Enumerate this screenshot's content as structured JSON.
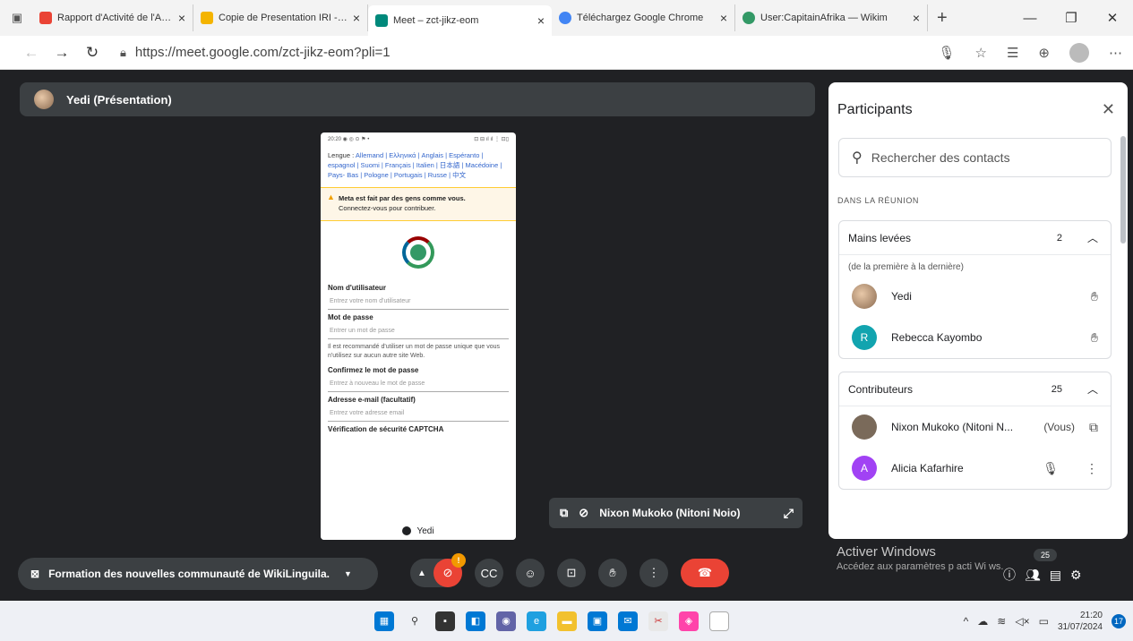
{
  "browser": {
    "tabs": [
      {
        "label": "Rapport d'Activité de l'Atelie",
        "color": "#ea4335"
      },
      {
        "label": "Copie de Presentation IRI - G",
        "color": "#f4b400"
      },
      {
        "label": "Meet – zct-jikz-eom",
        "color": "#00897b"
      },
      {
        "label": "Téléchargez Google Chrome",
        "color": "#4285f4"
      },
      {
        "label": "User:CapitainAfrika — Wikim",
        "color": "#339966"
      }
    ],
    "url": "https://meet.google.com/zct-jikz-eom?pli=1"
  },
  "presentation": {
    "presenter": "Yedi (Présentation)"
  },
  "phone": {
    "status_left": "20:20 ◉ ◎ ⊙ ⚑ •",
    "status_right": "⊡ ⊟ ıl ıl ⋮ ⊡▯",
    "lang_prefix": "Lengue : ",
    "lang_links": "Allemand | Ελληνικά | Anglais | Espéranto | espagnol | Suomi | Français | Italien | 日本語 | Macédoine | Pays- Bas | Pologne | Portugais | Russe | 中文",
    "warn_title": "Meta est fait par des gens comme vous.",
    "warn_text": "Connectez-vous pour contribuer.",
    "username_label": "Nom d'utilisateur",
    "username_ph": "Entrez votre nom d'utilisateur",
    "password_label": "Mot de passe",
    "password_ph": "Entrer un mot de passe",
    "password_hint": "Il est recommandé d'utiliser un mot de passe unique que vous n'utilisez sur aucun autre site Web.",
    "confirm_label": "Confirmez le mot de passe",
    "confirm_ph": "Entrez à nouveau le mot de passe",
    "email_label": "Adresse e-mail (facultatif)",
    "email_ph": "Entrez votre adresse email",
    "captcha_label": "Vérification de sécurité CAPTCHA",
    "footer_name": "Yedi"
  },
  "pinned": {
    "name": "Nixon Mukoko (Nitoni Noio)"
  },
  "meeting": {
    "title": "Formation des nouvelles communauté de WikiLinguila.",
    "mic_badge": "!"
  },
  "participants": {
    "title": "Participants",
    "search_placeholder": "Rechercher des contacts",
    "section": "DANS LA RÉUNION",
    "raised": {
      "title": "Mains levées",
      "count": "2",
      "subtitle": "(de la première à la dernière)",
      "people": [
        {
          "name": "Yedi",
          "initial": "",
          "color": "#a0785a"
        },
        {
          "name": "Rebecca Kayombo",
          "initial": "R",
          "color": "#12a4af"
        }
      ]
    },
    "contributors": {
      "title": "Contributeurs",
      "count": "25",
      "people": [
        {
          "name": "Nixon Mukoko (Nitoni N...",
          "suffix": "(Vous)",
          "initial": "",
          "color": "#7a6a5a"
        },
        {
          "name": "Alicia Kafarhire",
          "suffix": "",
          "initial": "A",
          "color": "#a142f4"
        }
      ]
    }
  },
  "overlay": {
    "activate_title": "Activer Windows",
    "activate_sub": "Accédez aux paramètres p   acti   Wi   ws.",
    "people_count": "25"
  },
  "taskbar": {
    "time": "21:20",
    "date": "31/07/2024",
    "notifications": "17"
  }
}
